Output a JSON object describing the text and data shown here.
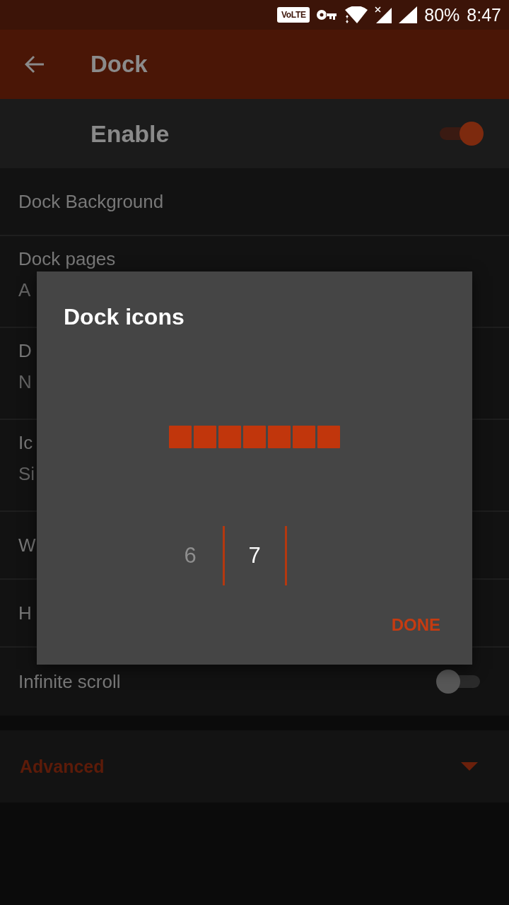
{
  "status_bar": {
    "volte": "VoLTE",
    "battery": "80%",
    "time": "8:47"
  },
  "app_bar": {
    "title": "Dock"
  },
  "enable": {
    "label": "Enable",
    "on": true
  },
  "settings": [
    {
      "kind": "text",
      "title": "Dock Background"
    },
    {
      "kind": "two_line",
      "title": "Dock pages",
      "summary": "A"
    },
    {
      "kind": "two_line",
      "title": "D",
      "summary": "N"
    },
    {
      "kind": "two_line",
      "title": "Ic",
      "summary": "Si"
    },
    {
      "kind": "text",
      "title": "W"
    },
    {
      "kind": "text",
      "title": "H"
    },
    {
      "kind": "switch",
      "title": "Infinite scroll",
      "on": false
    }
  ],
  "advanced": {
    "label": "Advanced",
    "expanded": false
  },
  "dialog": {
    "title": "Dock icons",
    "preview_tiles": [
      {
        "kind": "tile"
      },
      {
        "kind": "tile"
      },
      {
        "kind": "tile"
      },
      {
        "kind": "tile"
      },
      {
        "kind": "tile"
      },
      {
        "kind": "tile"
      },
      {
        "kind": "tile"
      }
    ],
    "picker": [
      {
        "label": "6",
        "selected": false
      },
      {
        "label": "7",
        "selected": true
      }
    ],
    "done": "DONE"
  }
}
